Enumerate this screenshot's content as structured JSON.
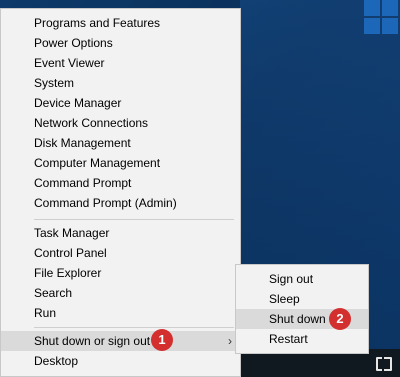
{
  "context_menu": {
    "items": [
      {
        "label": "Programs and Features"
      },
      {
        "label": "Power Options"
      },
      {
        "label": "Event Viewer"
      },
      {
        "label": "System"
      },
      {
        "label": "Device Manager"
      },
      {
        "label": "Network Connections"
      },
      {
        "label": "Disk Management"
      },
      {
        "label": "Computer Management"
      },
      {
        "label": "Command Prompt"
      },
      {
        "label": "Command Prompt (Admin)"
      },
      {
        "label": "Task Manager"
      },
      {
        "label": "Control Panel"
      },
      {
        "label": "File Explorer"
      },
      {
        "label": "Search"
      },
      {
        "label": "Run"
      },
      {
        "label": "Shut down or sign out",
        "highlighted": true,
        "has_submenu": true
      },
      {
        "label": "Desktop"
      }
    ],
    "submenu_arrow": "›"
  },
  "submenu": {
    "items": [
      {
        "label": "Sign out"
      },
      {
        "label": "Sleep"
      },
      {
        "label": "Shut down",
        "highlighted": true
      },
      {
        "label": "Restart"
      }
    ]
  },
  "annotations": {
    "badge1": "1",
    "badge2": "2",
    "badge_color": "#d32f2f"
  },
  "desktop": {
    "background_color": "#0b2f55",
    "taskbar_icon": "task-view-icon"
  }
}
